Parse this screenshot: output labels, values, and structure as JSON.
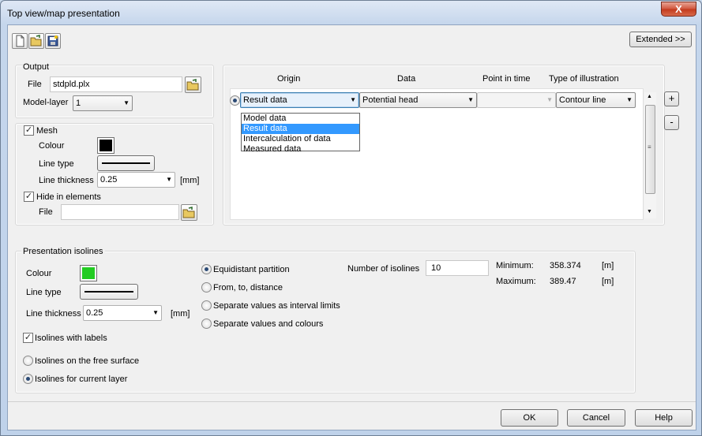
{
  "window": {
    "title": "Top view/map presentation",
    "close_label": "X"
  },
  "toolbar": {
    "extended_label": "Extended >>"
  },
  "output": {
    "group_label": "Output",
    "file_label": "File",
    "file_value": "stdpld.plx",
    "model_layer_label": "Model-layer",
    "model_layer_value": "1"
  },
  "mesh": {
    "label": "Mesh",
    "checked": true,
    "colour_label": "Colour",
    "colour": "#000000",
    "line_type_label": "Line type",
    "line_thickness_label": "Line thickness",
    "line_thickness_value": "0.25",
    "unit": "[mm]",
    "hide_label": "Hide in elements",
    "hide_checked": true,
    "file_label": "File",
    "file_value": ""
  },
  "table": {
    "headers": [
      "Origin",
      "Data",
      "Point in time",
      "Type of illustration"
    ],
    "row": {
      "origin": "Result data",
      "data": "Potential head",
      "point_in_time": "",
      "type": "Contour line"
    },
    "origin_options": [
      "Model data",
      "Result data",
      "Intercalculation of data",
      "Measured data"
    ],
    "origin_selected": "Result data",
    "add_label": "+",
    "remove_label": "-"
  },
  "isolines": {
    "group_label": "Presentation isolines",
    "colour_label": "Colour",
    "colour": "#22cc22",
    "line_type_label": "Line type",
    "line_thickness_label": "Line thickness",
    "line_thickness_value": "0.25",
    "unit": "[mm]",
    "labels_label": "Isolines with labels",
    "labels_checked": true,
    "free_surface_label": "Isolines on the free surface",
    "current_layer_label": "Isolines for current layer",
    "selected_scope": "current_layer",
    "partition_options": [
      "Equidistant partition",
      "From, to, distance",
      "Separate values as interval limits",
      "Separate values and colours"
    ],
    "partition_selected": "Equidistant partition",
    "number_label": "Number of isolines",
    "number_value": "10",
    "minimum_label": "Minimum:",
    "minimum_value": "358.374",
    "maximum_label": "Maximum:",
    "maximum_value": "389.47",
    "minmax_unit": "[m]"
  },
  "footer": {
    "ok_label": "OK",
    "cancel_label": "Cancel",
    "help_label": "Help"
  }
}
